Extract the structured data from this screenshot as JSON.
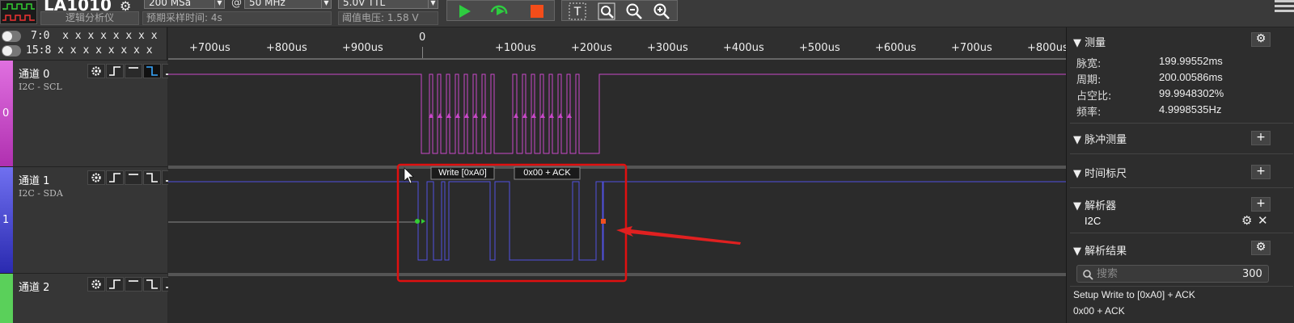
{
  "toolbar": {
    "brand": "LA1010",
    "subtitle": "逻辑分析仪",
    "sample_rate": "200 MSa",
    "at": "@",
    "sample_freq": "50 MHz",
    "voltage_mode": "5.0V TTL",
    "sample_time_label": "预期采样时间: 4s",
    "threshold_label": "阈值电压: 1.58 V"
  },
  "triggers": [
    {
      "label": "7:0",
      "pattern": "x x x x x x x x"
    },
    {
      "label": "15:8",
      "pattern": "x x x x x x x x"
    }
  ],
  "channels": [
    {
      "index": "0",
      "name": "通道 0",
      "desc": "I2C - SCL",
      "color": "#d04ad0"
    },
    {
      "index": "1",
      "name": "通道 1",
      "desc": "I2C - SDA",
      "color": "#4a4ae0"
    },
    {
      "index": "2",
      "name": "通道 2",
      "desc": "",
      "color": "#4ac84a"
    }
  ],
  "ruler": {
    "ticks": [
      {
        "label": "+700us"
      },
      {
        "label": "+800us"
      },
      {
        "label": "+900us"
      },
      {
        "label": "0"
      },
      {
        "label": "+100us"
      },
      {
        "label": "+200us"
      },
      {
        "label": "+300us"
      },
      {
        "label": "+400us"
      },
      {
        "label": "+500us"
      },
      {
        "label": "+600us"
      },
      {
        "label": "+700us"
      },
      {
        "label": "+800us"
      }
    ]
  },
  "decode": {
    "labels": [
      "Write [0xA0]",
      "0x00 + ACK"
    ]
  },
  "right": {
    "measure_title": "▼ 测量",
    "measurements": [
      {
        "label": "脉宽:",
        "value": "199.99552ms"
      },
      {
        "label": "周期:",
        "value": "200.00586ms"
      },
      {
        "label": "占空比:",
        "value": "99.9948302%"
      },
      {
        "label": "频率:",
        "value": "4.9998535Hz"
      }
    ],
    "pulse_title": "▼ 脉冲测量",
    "marker_title": "▼ 时间标尺",
    "decoder_title": "▼ 解析器",
    "decoder_item": "I2C",
    "results_title": "▼ 解析结果",
    "search_placeholder": "搜索",
    "search_count": "300",
    "results": [
      "Setup Write to [0xA0] + ACK",
      "0x00 + ACK"
    ]
  },
  "colors": {
    "scl": "#c848c8",
    "sda": "#5050e0",
    "highlight": "#e01010",
    "arrow": "#e02020"
  }
}
